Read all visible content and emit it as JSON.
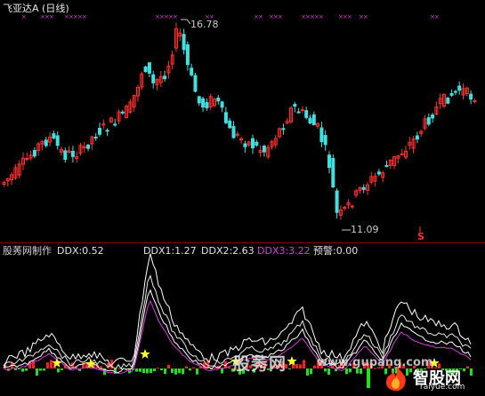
{
  "header": {
    "title": "飞亚达A (日线)"
  },
  "price_annotations": {
    "high_label": "16.78",
    "low_label": "11.09",
    "signal_mark": "S"
  },
  "indicator": {
    "name": "股莠网制作",
    "ddx": "DDX:0.52",
    "ddx1": "DDX1:1.27",
    "ddx2": "DDX2:2.63",
    "ddx3": "DDX3:3.22",
    "warning": "预警:0.00"
  },
  "watermark": {
    "site_cn": "股莠网",
    "site_url": "www.gupang.com",
    "logo_text": "智股网",
    "logo_url": "raiyue.com"
  },
  "colors": {
    "up": "#ff3030",
    "down": "#40e0e0",
    "marker": "#d040d0",
    "ddx_pos": "#ff2020",
    "ddx_neg": "#20e020",
    "star": "#ffff30"
  }
}
